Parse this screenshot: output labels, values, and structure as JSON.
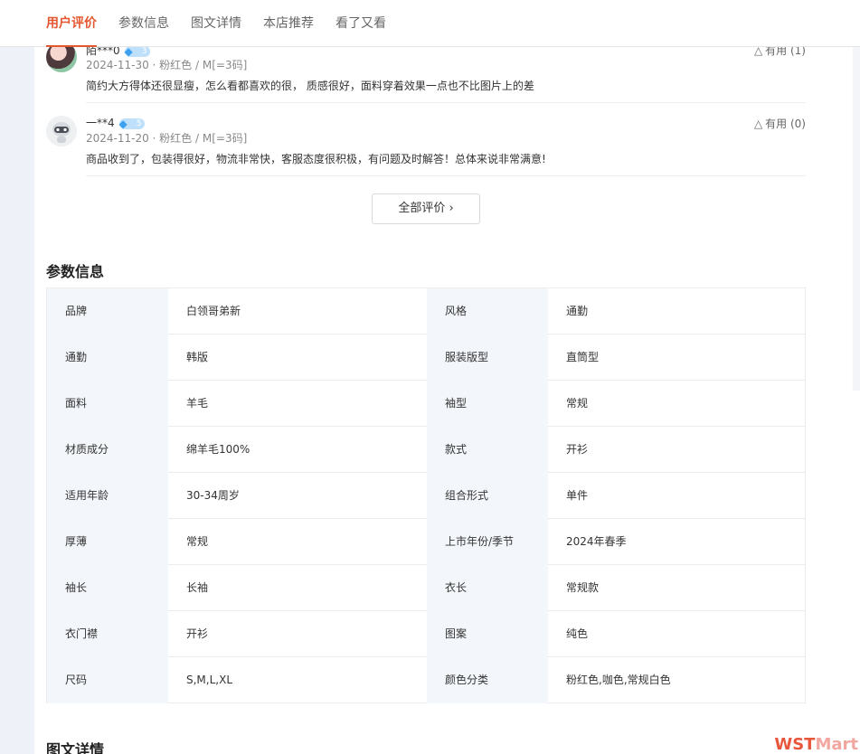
{
  "nav": {
    "tabs": [
      {
        "label": "用户评价",
        "active": true
      },
      {
        "label": "参数信息"
      },
      {
        "label": "图文详情"
      },
      {
        "label": "本店推荐"
      },
      {
        "label": "看了又看"
      }
    ]
  },
  "reviews": [
    {
      "username": "陌***0",
      "level": "3",
      "meta": "2024-11-30 · 粉红色 / M[=3码]",
      "text": "简约大方得体还很显瘦，怎么看都喜欢的很， 质感很好，面料穿着效果一点也不比图片上的差",
      "useful": "有用 (1)"
    },
    {
      "username": "一**4",
      "level": "5",
      "meta": "2024-11-20 · 粉红色 / M[=3码]",
      "text": "商品收到了，包装得很好，物流非常快，客服态度很积极，有问题及时解答！总体来说非常满意!",
      "useful": "有用 (0)"
    }
  ],
  "all_reviews_button": "全部评价 ›",
  "params_title": "参数信息",
  "params": [
    {
      "k1": "品牌",
      "v1": "白领哥弟新",
      "k2": "风格",
      "v2": "通勤"
    },
    {
      "k1": "通勤",
      "v1": "韩版",
      "k2": "服装版型",
      "v2": "直筒型"
    },
    {
      "k1": "面料",
      "v1": "羊毛",
      "k2": "袖型",
      "v2": "常规"
    },
    {
      "k1": "材质成分",
      "v1": "绵羊毛100%",
      "k2": "款式",
      "v2": "开衫"
    },
    {
      "k1": "适用年龄",
      "v1": "30-34周岁",
      "k2": "组合形式",
      "v2": "单件"
    },
    {
      "k1": "厚薄",
      "v1": "常规",
      "k2": "上市年份/季节",
      "v2": "2024年春季"
    },
    {
      "k1": "袖长",
      "v1": "长袖",
      "k2": "衣长",
      "v2": "常规款"
    },
    {
      "k1": "衣门襟",
      "v1": "开衫",
      "k2": "图案",
      "v2": "纯色"
    },
    {
      "k1": "尺码",
      "v1": "S,M,L,XL",
      "k2": "颜色分类",
      "v2": "粉红色,咖色,常规白色"
    }
  ],
  "detail_title": "图文详情",
  "brand": {
    "ws": "WST",
    "mart": "Mart"
  },
  "colors": {
    "accent": "#e4572e",
    "label_bg": "#f3f6fa"
  }
}
